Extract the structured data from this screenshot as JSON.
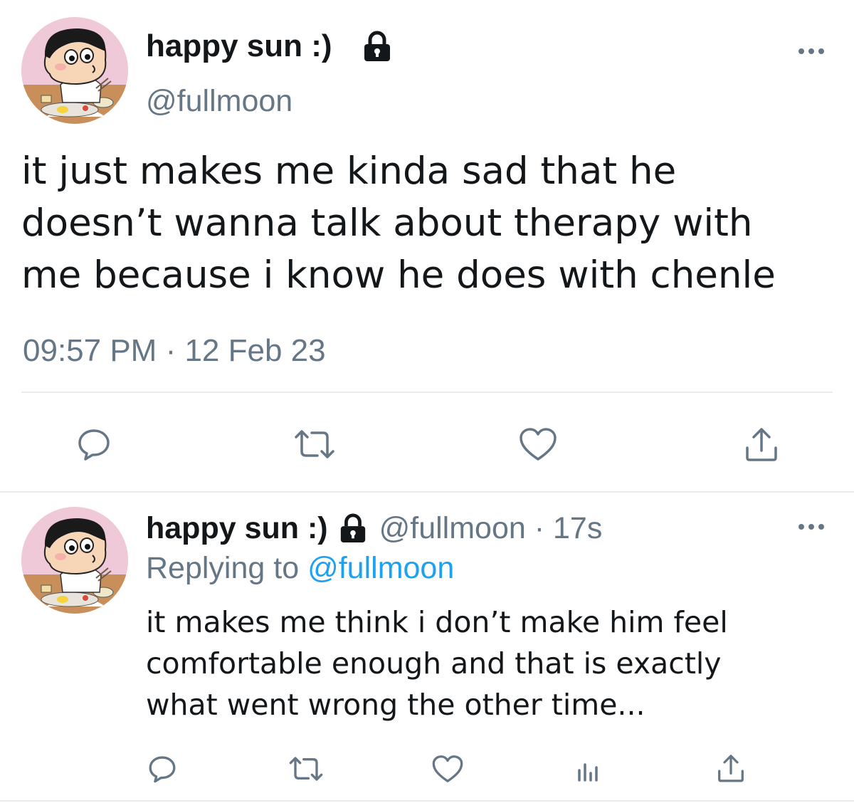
{
  "colors": {
    "text": "#14171a",
    "secondary": "#657786",
    "link": "#1da1f2",
    "divider": "#e6ecf0",
    "icon": "#657786"
  },
  "main_tweet": {
    "avatar": "cartoon-avatar",
    "display_name": "happy sun :)",
    "protected_icon": "lock-icon",
    "handle": "@fullmoon",
    "more_icon": "more-icon",
    "text_lines": [
      "it just makes me kinda sad that he",
      "doesn’t wanna talk about therapy with",
      "me because i know he does with chenle"
    ],
    "time": "09:57 PM",
    "separator": " · ",
    "date": "12 Feb 23",
    "actions": [
      {
        "name": "reply",
        "icon": "reply-icon"
      },
      {
        "name": "retweet",
        "icon": "retweet-icon"
      },
      {
        "name": "like",
        "icon": "heart-icon"
      },
      {
        "name": "share",
        "icon": "share-icon"
      }
    ]
  },
  "reply_tweet": {
    "avatar": "cartoon-avatar",
    "display_name": "happy sun :)",
    "protected_icon": "lock-icon",
    "handle_time": "@fullmoon · 17s",
    "more_icon": "more-icon",
    "replying_prefix": "Replying to ",
    "replying_mention": "@fullmoon",
    "text_lines": [
      "it makes me think i don’t make him feel",
      "comfortable enough and that is exactly",
      "what went wrong the other time..."
    ],
    "actions": [
      {
        "name": "reply",
        "icon": "reply-icon"
      },
      {
        "name": "retweet",
        "icon": "retweet-icon"
      },
      {
        "name": "like",
        "icon": "heart-icon"
      },
      {
        "name": "analytics",
        "icon": "analytics-icon"
      },
      {
        "name": "share",
        "icon": "share-icon"
      }
    ]
  }
}
